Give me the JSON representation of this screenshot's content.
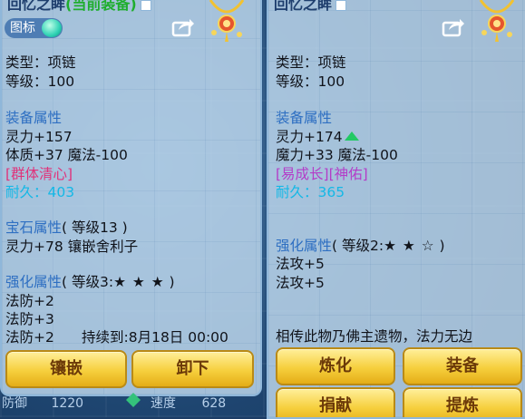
{
  "left": {
    "title": "回忆之眸",
    "title_status": "(当前装备)",
    "icon_toggle_label": "图标",
    "type_line": "类型：项链",
    "level_line": "等级：100",
    "equip_attr_label": "装备属性",
    "stat1": "灵力+157",
    "stat2": "体质+37  魔法-100",
    "special": "[群体清心]",
    "durability": "耐久：403",
    "gem_attr_label": "宝石属性",
    "gem_level": "( 等级13 )",
    "gem_stat": "灵力+78  镶嵌舍利子",
    "enh_attr_label": "强化属性",
    "enh_level": "( 等级3:",
    "enh_stars": "★ ★ ★",
    "enh_close": " )",
    "enh1": "法防+2",
    "enh2": "法防+3",
    "enh3": "法防+2",
    "enh3_duration": "持续到:8月18日 00:00",
    "btn_inlay": "镶嵌",
    "btn_unequip": "卸下",
    "bottom_left_label": "防御",
    "bottom_left_value": "1220",
    "bottom_right_label": "速度",
    "bottom_right_value": "628"
  },
  "right": {
    "title": "回忆之眸",
    "type_line": "类型：项链",
    "level_line": "等级：100",
    "equip_attr_label": "装备属性",
    "stat1": "灵力+174",
    "stat2": "魔力+33  魔法-100",
    "special": "[易成长][神佑]",
    "durability": "耐久：365",
    "enh_attr_label": "强化属性",
    "enh_level": "( 等级2:",
    "enh_stars": "★ ★ ☆",
    "enh_close": " )",
    "enh1": "法攻+5",
    "enh2": "法攻+5",
    "description": "相传此物乃佛主遗物，法力无边",
    "btn_refine": "炼化",
    "btn_equip": "装备",
    "btn_donate": "捐献",
    "btn_extract": "提炼"
  },
  "colors": {
    "section_blue": "#2e6fc2",
    "special_pink": "#e0327a",
    "special_purple": "#b43cc8",
    "durability_cyan": "#13b8e6",
    "button_gold": "#f6cf3d",
    "equipped_green": "#1fae2e"
  }
}
